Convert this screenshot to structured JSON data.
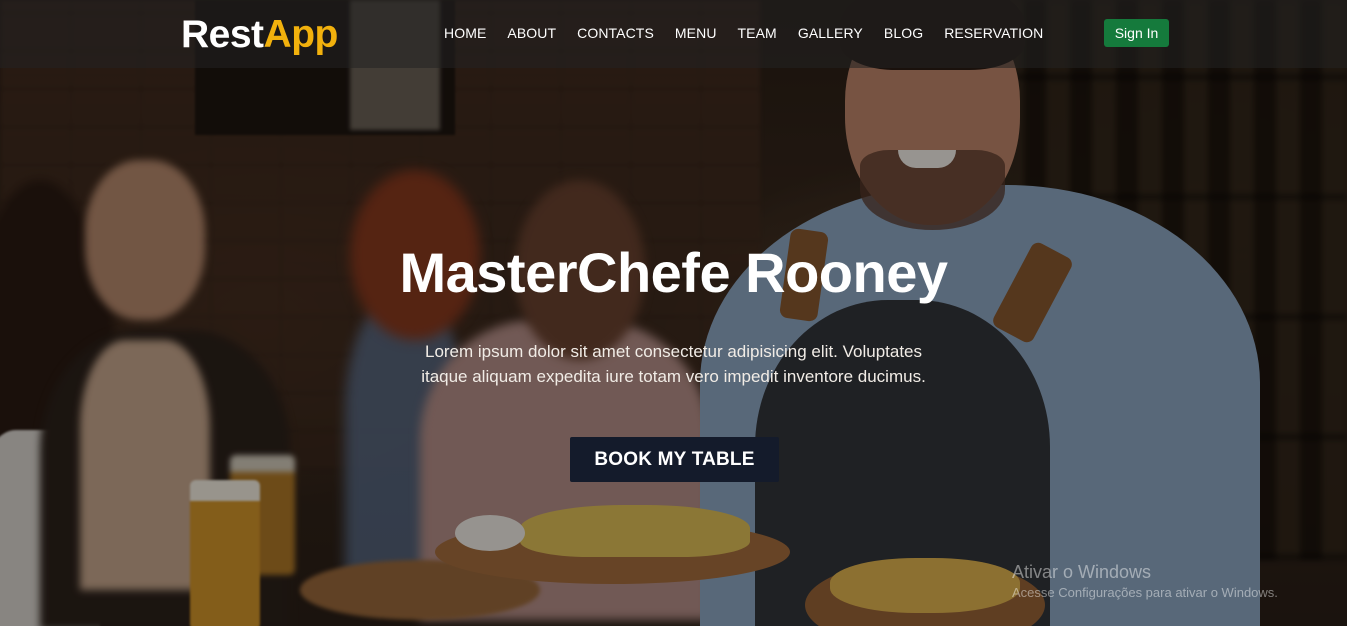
{
  "brand": {
    "part1": "Rest",
    "part2": "App",
    "accent_color": "#f2b10d"
  },
  "nav": {
    "items": [
      {
        "label": "HOME"
      },
      {
        "label": "ABOUT"
      },
      {
        "label": "CONTACTS"
      },
      {
        "label": "MENU"
      },
      {
        "label": "TEAM"
      },
      {
        "label": "GALLERY"
      },
      {
        "label": "BLOG"
      },
      {
        "label": "RESERVATION"
      }
    ],
    "signin_label": "Sign In",
    "signin_color": "#157a3c"
  },
  "hero": {
    "title": "MasterChefe Rooney",
    "text": "Lorem ipsum dolor sit amet consectetur adipisicing elit. Voluptates itaque aliquam expedita iure totam vero impedit inventore ducimus.",
    "cta_label": "BOOK MY TABLE",
    "cta_color": "#141b2b"
  },
  "watermark": {
    "title": "Ativar o Windows",
    "subtitle": "Acesse Configurações para ativar o Windows."
  }
}
